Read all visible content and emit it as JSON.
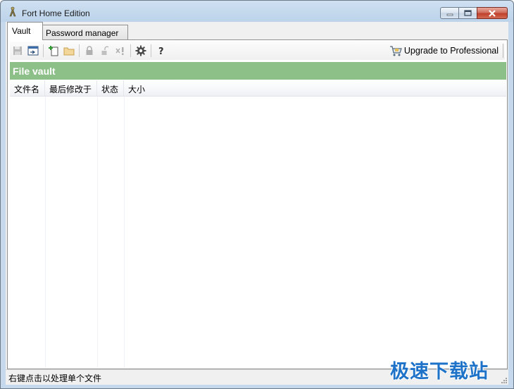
{
  "window": {
    "title": "Fort Home Edition"
  },
  "tabs": [
    {
      "label": "Vault",
      "active": true
    },
    {
      "label": "Password manager",
      "active": false
    }
  ],
  "toolbar": {
    "buttons": [
      {
        "icon": "save-icon",
        "enabled": false
      },
      {
        "icon": "open-vault-icon",
        "enabled": true
      },
      {
        "icon": "add-file-icon",
        "enabled": true
      },
      {
        "icon": "add-folder-icon",
        "enabled": false
      },
      {
        "icon": "lock-icon",
        "enabled": false
      },
      {
        "icon": "unlock-icon",
        "enabled": false
      },
      {
        "icon": "delete-icon",
        "enabled": false
      },
      {
        "icon": "settings-icon",
        "enabled": true
      },
      {
        "icon": "help-icon",
        "enabled": true
      }
    ],
    "upgrade_label": "Upgrade to Professional"
  },
  "section": {
    "title": "File vault"
  },
  "table": {
    "columns": [
      "文件名",
      "最后修改于",
      "状态",
      "大小"
    ],
    "rows": []
  },
  "status": {
    "text": "右键点击以处理单个文件"
  },
  "watermark": {
    "text": "极速下载站"
  },
  "colors": {
    "section_header": "#8dbf88",
    "close_button": "#c0412c",
    "watermark": "#1e73c9"
  }
}
